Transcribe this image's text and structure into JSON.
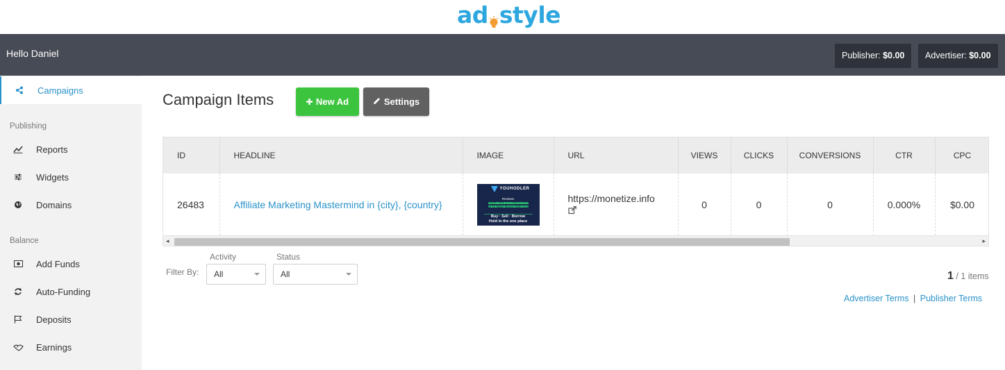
{
  "brand": {
    "logo_left": "ad",
    "logo_right": "style",
    "color": "#2ea7df"
  },
  "header": {
    "greeting": "Hello Daniel",
    "publisher_label": "Publisher:",
    "publisher_value": "$0.00",
    "advertiser_label": "Advertiser:",
    "advertiser_value": "$0.00"
  },
  "sidebar": {
    "top_item": {
      "label": "Campaigns",
      "icon": "share-icon"
    },
    "section_publishing": "Publishing",
    "publishing_items": [
      {
        "label": "Reports",
        "icon": "chart-line-icon"
      },
      {
        "label": "Widgets",
        "icon": "sliders-icon"
      },
      {
        "label": "Domains",
        "icon": "globe-icon"
      }
    ],
    "section_balance": "Balance",
    "balance_items": [
      {
        "label": "Add Funds",
        "icon": "money-icon"
      },
      {
        "label": "Auto-Funding",
        "icon": "refresh-icon"
      },
      {
        "label": "Deposits",
        "icon": "flag-icon"
      },
      {
        "label": "Earnings",
        "icon": "handshake-icon"
      }
    ]
  },
  "main": {
    "title": "Campaign Items",
    "new_ad_label": "New Ad",
    "settings_label": "Settings",
    "table": {
      "columns": [
        "ID",
        "HEADLINE",
        "IMAGE",
        "URL",
        "VIEWS",
        "CLICKS",
        "CONVERSIONS",
        "CTR",
        "CPC"
      ],
      "rows": [
        {
          "id": "26483",
          "headline": "Affiliate Marketing Mastermind in {city}, {country}",
          "image_brand": "YOUHODLER",
          "image_lines": [
            "Reviews",
            "YouHodler Web 3.0 Platform Review",
            "How To Make Money With Crypto",
            "Buy · Sell · Borrow",
            "Hold in the one place"
          ],
          "url": "https://monetize.info",
          "views": "0",
          "clicks": "0",
          "conversions": "0",
          "ctr": "0.000%",
          "cpc": "$0.00"
        }
      ]
    },
    "filters": {
      "label": "Filter By:",
      "activity_caption": "Activity",
      "activity_value": "All",
      "status_caption": "Status",
      "status_value": "All"
    },
    "pager": {
      "current": "1",
      "total_text": "/ 1 items"
    },
    "footer_links": {
      "advertiser_terms": "Advertiser Terms",
      "separator": "|",
      "publisher_terms": "Publisher Terms"
    }
  },
  "colors": {
    "topbar": "#474b55",
    "accent": "#2a92c9",
    "new_button": "#3dc43f",
    "settings_button": "#616161"
  }
}
